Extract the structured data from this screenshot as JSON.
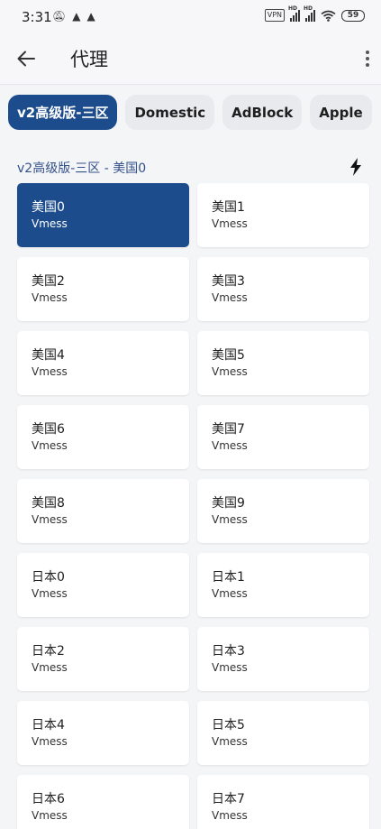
{
  "status_bar": {
    "time": "3:31",
    "notifications": [
      "notification-bell-muted-icon",
      "cat-icon",
      "cat-icon"
    ],
    "vpn_label": "VPN",
    "hd_label": "HD",
    "battery": "59"
  },
  "app_bar": {
    "title": "代理",
    "back_icon": "arrow-left-icon",
    "menu_icon": "more-vertical-icon"
  },
  "chips": [
    {
      "label": "v2高级版-三区",
      "active": true
    },
    {
      "label": "Domestic",
      "active": false
    },
    {
      "label": "AdBlock",
      "active": false
    },
    {
      "label": "Apple",
      "active": false
    }
  ],
  "group": {
    "title": "v2高级版-三区 - 美国0",
    "action_icon": "lightning-bolt-icon"
  },
  "proxies": [
    {
      "name": "美国0",
      "type": "Vmess",
      "selected": true
    },
    {
      "name": "美国1",
      "type": "Vmess",
      "selected": false
    },
    {
      "name": "美国2",
      "type": "Vmess",
      "selected": false
    },
    {
      "name": "美国3",
      "type": "Vmess",
      "selected": false
    },
    {
      "name": "美国4",
      "type": "Vmess",
      "selected": false
    },
    {
      "name": "美国5",
      "type": "Vmess",
      "selected": false
    },
    {
      "name": "美国6",
      "type": "Vmess",
      "selected": false
    },
    {
      "name": "美国7",
      "type": "Vmess",
      "selected": false
    },
    {
      "name": "美国8",
      "type": "Vmess",
      "selected": false
    },
    {
      "name": "美国9",
      "type": "Vmess",
      "selected": false
    },
    {
      "name": "日本0",
      "type": "Vmess",
      "selected": false
    },
    {
      "name": "日本1",
      "type": "Vmess",
      "selected": false
    },
    {
      "name": "日本2",
      "type": "Vmess",
      "selected": false
    },
    {
      "name": "日本3",
      "type": "Vmess",
      "selected": false
    },
    {
      "name": "日本4",
      "type": "Vmess",
      "selected": false
    },
    {
      "name": "日本5",
      "type": "Vmess",
      "selected": false
    },
    {
      "name": "日本6",
      "type": "Vmess",
      "selected": false
    },
    {
      "name": "日本7",
      "type": "Vmess",
      "selected": false
    }
  ],
  "colors": {
    "accent": "#1d4c8d",
    "group_title": "#33518a",
    "background": "#f4f5f7"
  }
}
